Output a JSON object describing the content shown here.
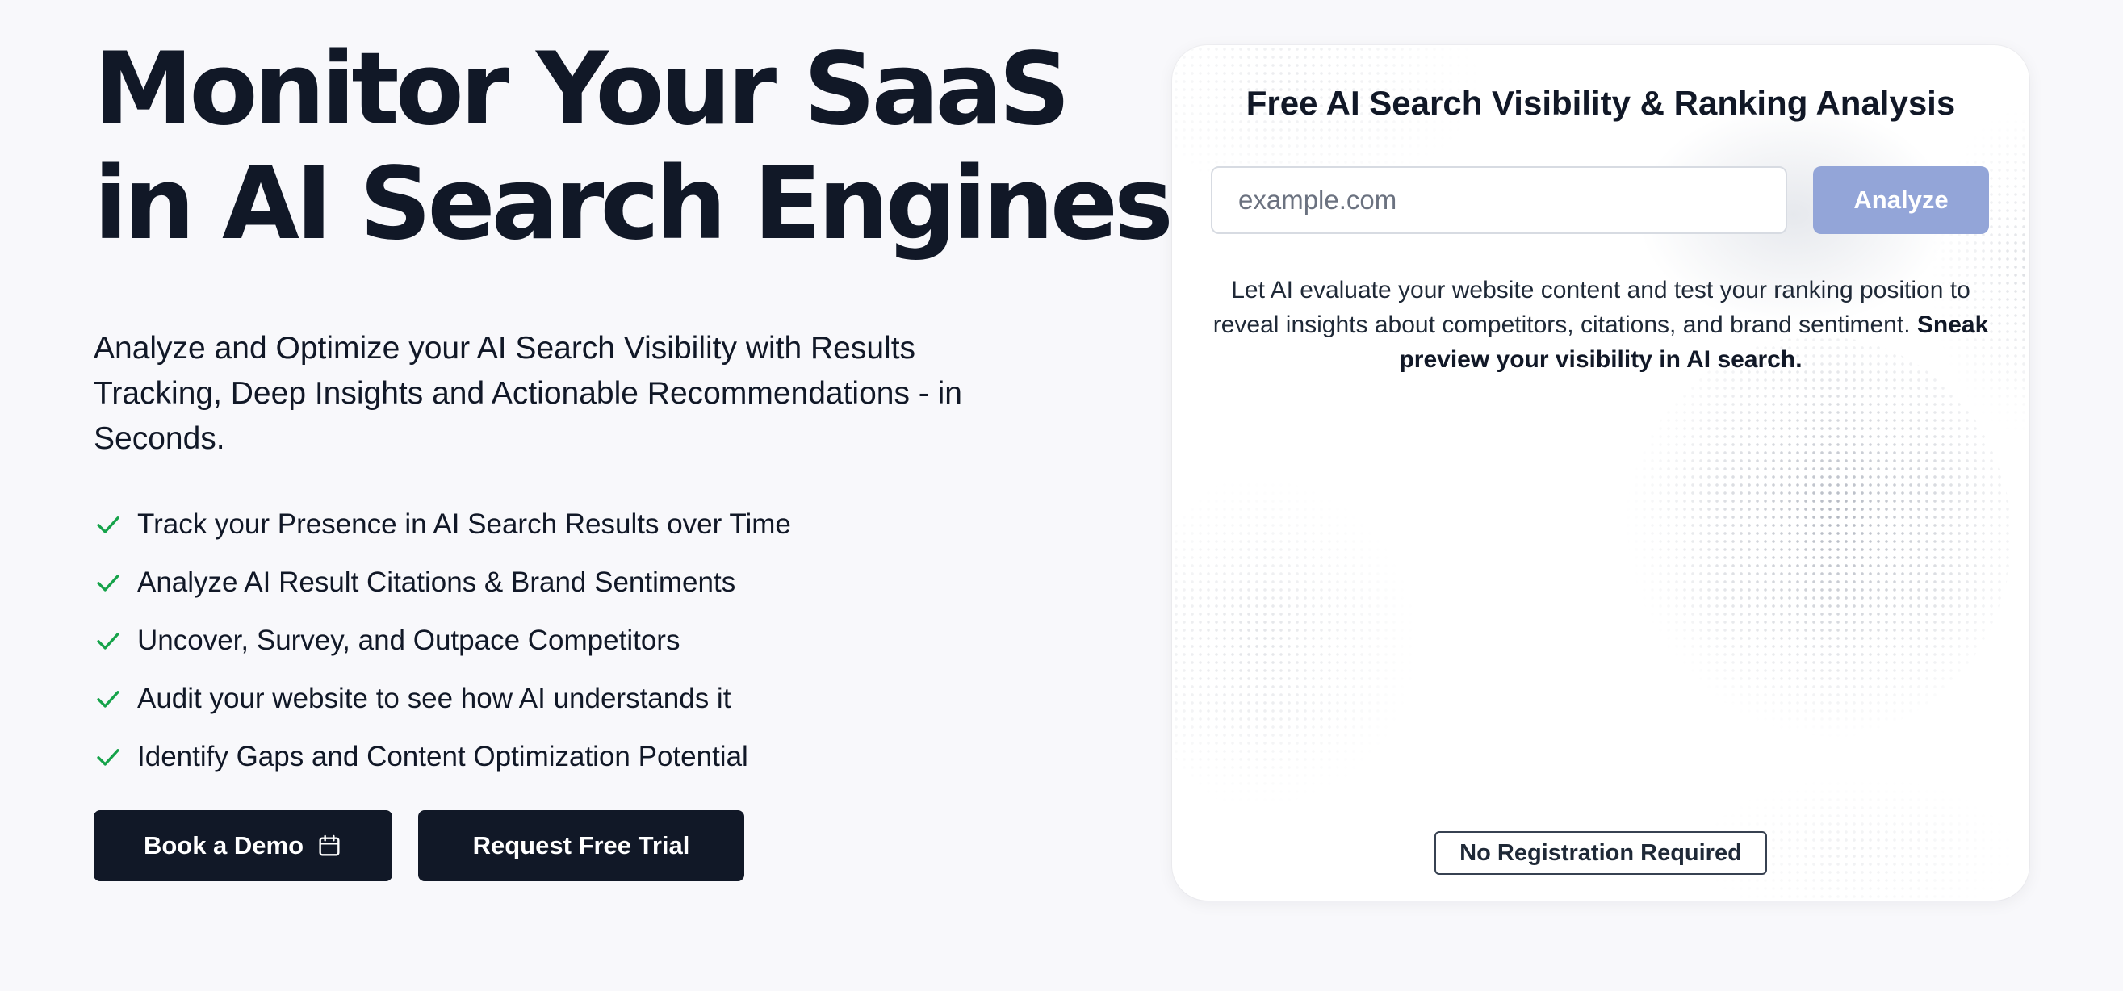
{
  "hero": {
    "title_line1": "Monitor Your SaaS",
    "title_line2": "in AI Search Engines",
    "subtitle": "Analyze and Optimize your AI Search Visibility with Results Tracking, Deep Insights and Actionable Recommendations - in Seconds."
  },
  "features": [
    "Track your Presence in AI Search Results over Time",
    "Analyze AI Result Citations & Brand Sentiments",
    "Uncover, Survey, and Outpace Competitors",
    "Audit your website to see how AI understands it",
    "Identify Gaps and Content Optimization Potential"
  ],
  "cta": {
    "demo_label": "Book a Demo",
    "trial_label": "Request Free Trial"
  },
  "card": {
    "title": "Free AI Search Visibility & Ranking Analysis",
    "input_value": "",
    "input_placeholder": "example.com",
    "analyze_label": "Analyze",
    "description": "Let AI evaluate your website content and test your ranking position to reveal insights about competitors, citations, and brand sentiment.",
    "description_bold": "Sneak preview your visibility in AI search.",
    "badge": "No Registration Required"
  },
  "colors": {
    "text_dark": "#111827",
    "background": "#f8f8fb",
    "button_dark": "#111827",
    "analyze_button": "#93a5d8",
    "check_green": "#16a34a"
  },
  "icons": {
    "feature_check": "check-icon",
    "demo_button": "calendar-icon"
  }
}
